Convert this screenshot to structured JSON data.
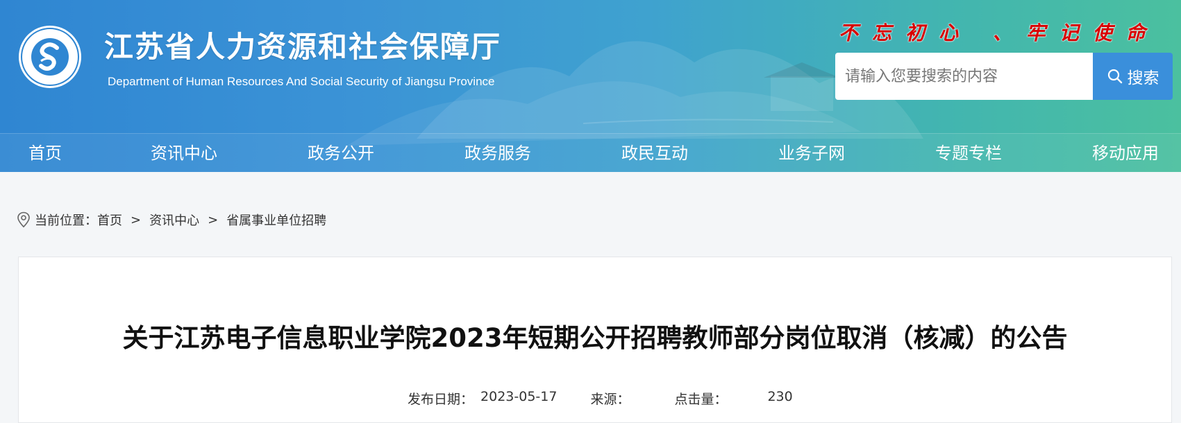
{
  "header": {
    "title": "江苏省人力资源和社会保障厅",
    "subtitle": "Department of Human Resources And Social Security of Jiangsu Province",
    "logo_text": "江苏省人力资源和社会保障厅",
    "slogan": "不忘初心 、牢记使命"
  },
  "search": {
    "placeholder": "请输入您要搜索的内容",
    "button_label": "搜索"
  },
  "nav": {
    "items": [
      {
        "label": "首页"
      },
      {
        "label": "资讯中心"
      },
      {
        "label": "政务公开"
      },
      {
        "label": "政务服务"
      },
      {
        "label": "政民互动"
      },
      {
        "label": "业务子网"
      },
      {
        "label": "专题专栏"
      },
      {
        "label": "移动应用"
      }
    ]
  },
  "breadcrumb": {
    "prefix": "当前位置：",
    "items": [
      "首页",
      "资讯中心",
      "省属事业单位招聘"
    ],
    "separator": ">"
  },
  "article": {
    "title": "关于江苏电子信息职业学院2023年短期公开招聘教师部分岗位取消（核减）的公告",
    "meta": {
      "date_label": "发布日期：",
      "date": "2023-05-17",
      "source_label": "来源：",
      "source": "",
      "views_label": "点击量：",
      "views": "230"
    }
  },
  "colors": {
    "header_start": "#2f86d2",
    "header_end": "#4bc09f",
    "slogan": "#d80000",
    "search_button": "#3a8fdb"
  },
  "icons": {
    "logo": "logo-icon",
    "search": "search-icon",
    "location": "location-pin-icon"
  }
}
